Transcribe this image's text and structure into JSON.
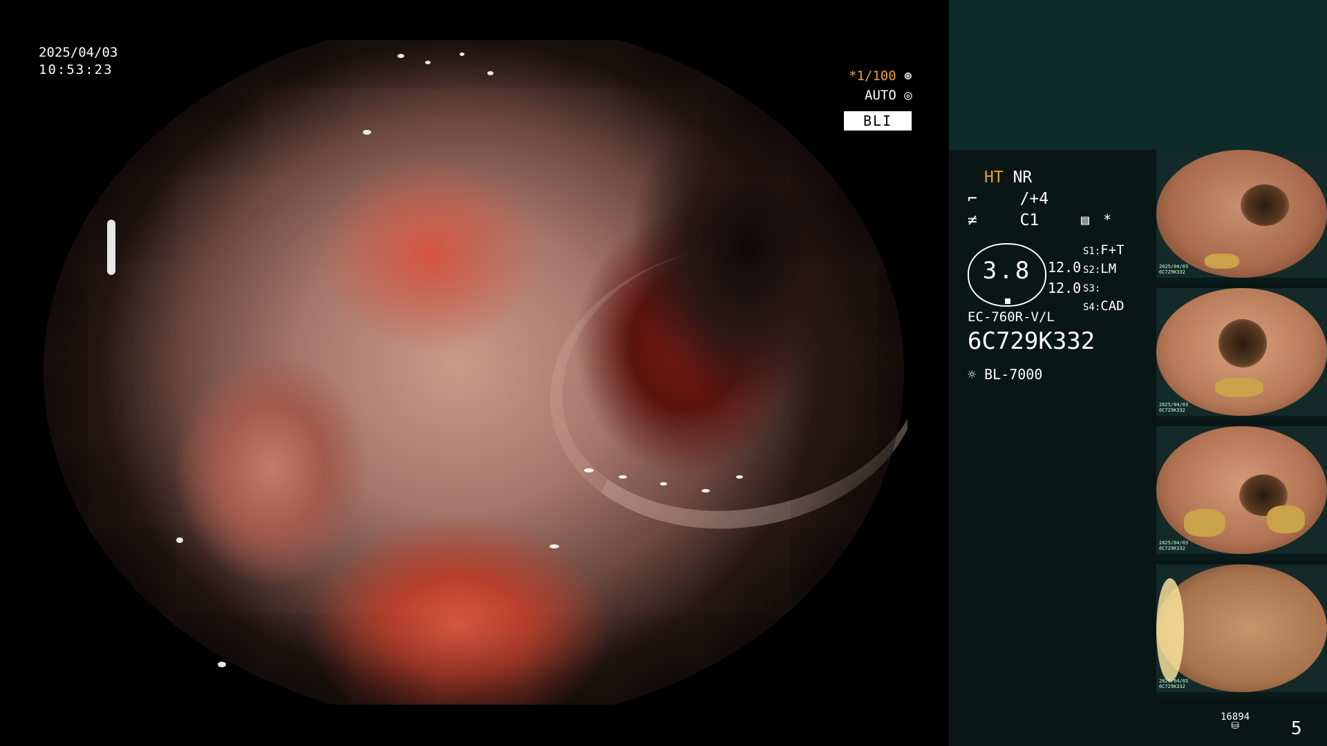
{
  "overlay": {
    "date": "2025/04/03",
    "time": "10:53:23",
    "shutter": "*1/100",
    "iris_mode": "AUTO",
    "mode_badge": "BLI"
  },
  "panel": {
    "ht": "HT",
    "nr": "NR",
    "enhance": "/+4",
    "color": "C1",
    "asterisk": "*",
    "gauge_value": "3.8",
    "val_a": "12.0",
    "val_b": "12.0",
    "s1_label": "S1:",
    "s1_value": "F+T",
    "s2_label": "S2:",
    "s2_value": "LM",
    "s3_label": "S3:",
    "s3_value": "",
    "s4_label": "S4:",
    "s4_value": "CAD",
    "scope_model": "EC-760R-V/L",
    "serial": "6C729K332",
    "light_source": "BL-7000",
    "counter": "16894",
    "page": "5"
  },
  "thumbnails": [
    {
      "caption_line1": "2025/04/03",
      "caption_line2": "6C729K332"
    },
    {
      "caption_line1": "2025/04/03",
      "caption_line2": "6C729K332"
    },
    {
      "caption_line1": "2025/04/03",
      "caption_line2": "6C729K332"
    },
    {
      "caption_line1": "2025/04/03",
      "caption_line2": "6C729K332"
    }
  ],
  "colors": {
    "accent_orange": "#f0a020",
    "panel_bg": "#081615",
    "panel_top_bg": "#0d2b29"
  },
  "icons": [
    "shutter-icon",
    "iris-icon",
    "enhance-icon",
    "color-icon",
    "settings-icon",
    "lamp-icon",
    "storage-icon"
  ]
}
